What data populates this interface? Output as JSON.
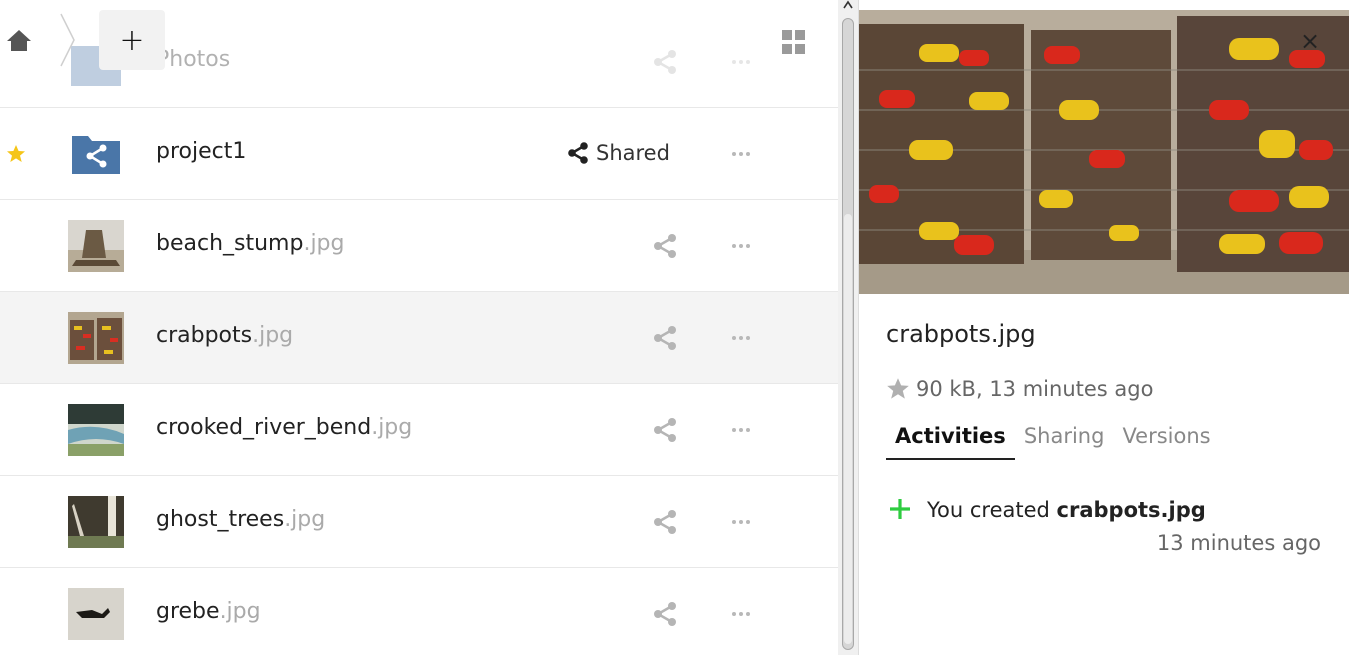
{
  "breadcrumb": {
    "new_label": "+"
  },
  "files": [
    {
      "name": "Photos",
      "ext": "",
      "starred": false,
      "shared": false,
      "type": "folder"
    },
    {
      "name": "project1",
      "ext": "",
      "starred": true,
      "shared": true,
      "shared_label": "Shared",
      "type": "shared-folder"
    },
    {
      "name": "beach_stump",
      "ext": ".jpg",
      "starred": false,
      "shared": false,
      "type": "image"
    },
    {
      "name": "crabpots",
      "ext": ".jpg",
      "starred": false,
      "shared": false,
      "type": "image",
      "selected": true
    },
    {
      "name": "crooked_river_bend",
      "ext": ".jpg",
      "starred": false,
      "shared": false,
      "type": "image"
    },
    {
      "name": "ghost_trees",
      "ext": ".jpg",
      "starred": false,
      "shared": false,
      "type": "image"
    },
    {
      "name": "grebe",
      "ext": ".jpg",
      "starred": false,
      "shared": false,
      "type": "image"
    }
  ],
  "sidebar": {
    "close_label": "×",
    "filename": "crabpots.jpg",
    "meta": "90 kB, 13 minutes ago",
    "tabs": [
      {
        "label": "Activities",
        "active": true
      },
      {
        "label": "Sharing",
        "active": false
      },
      {
        "label": "Versions",
        "active": false
      }
    ],
    "activity": {
      "prefix": "You created ",
      "file": "crabpots.jpg",
      "time": "13 minutes ago"
    }
  },
  "colors": {
    "star": "#f5c518",
    "folder": "#4a76a8",
    "activity_plus": "#2ecc40",
    "share_icon": "#b5b5b5"
  }
}
